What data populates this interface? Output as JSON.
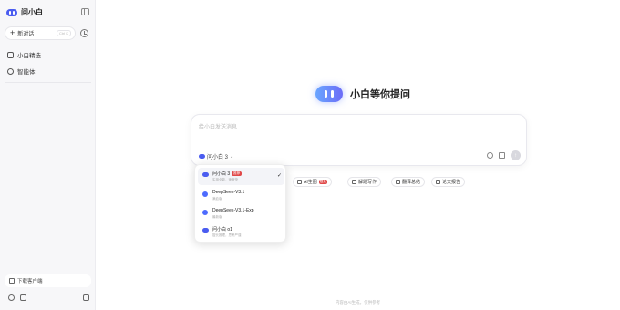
{
  "app": {
    "name": "问小白"
  },
  "sidebar": {
    "new_chat_label": "新对话",
    "new_chat_shortcut": "Ctrl K",
    "items": [
      {
        "label": "小白精选"
      },
      {
        "label": "智能体"
      }
    ],
    "download_label": "下载客户端"
  },
  "main": {
    "hero_title": "小白等你提问",
    "input_placeholder": "给小白发送消息",
    "selected_model": "问小白 3",
    "models": [
      {
        "name": "问小白 3",
        "badge": "推荐",
        "desc": "实用全能，速度快",
        "selected": true
      },
      {
        "name": "DeepSeek-V3.1",
        "desc": "满血版",
        "selected": false
      },
      {
        "name": "DeepSeek-V3.1-Exp",
        "desc": "最新版",
        "selected": false
      },
      {
        "name": "问小白 o1",
        "desc": "擅长推理，思考严谨",
        "selected": false
      }
    ],
    "chips": [
      {
        "label": "AI生图",
        "hot": "限免"
      },
      {
        "label": "解题写作"
      },
      {
        "label": "翻译总结"
      },
      {
        "label": "论文报告"
      }
    ],
    "footer": "内容由AI生成，仅供参考"
  },
  "colors": {
    "brand": "#4a5cf0",
    "badge": "#e04848"
  }
}
